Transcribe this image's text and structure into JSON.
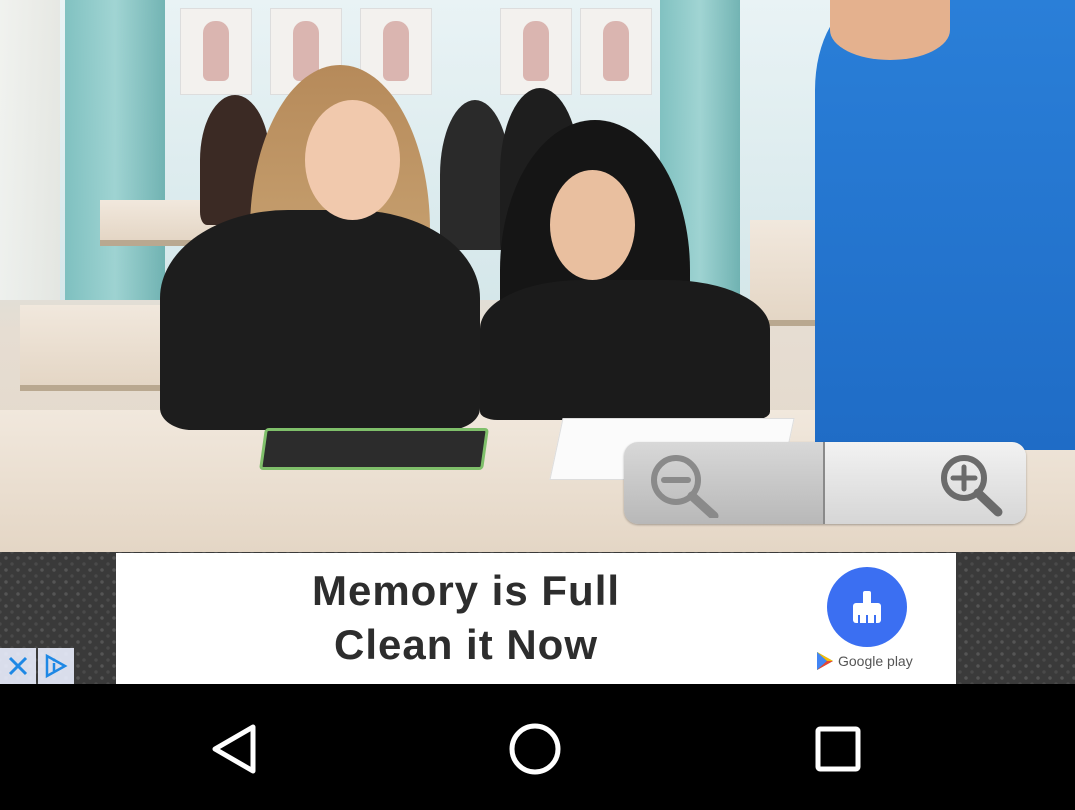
{
  "photo": {
    "alt_icon": "classroom-photo"
  },
  "zoom": {
    "zoom_out_icon": "zoom-out-icon",
    "zoom_in_icon": "zoom-in-icon"
  },
  "ad": {
    "line1": "Memory is Full",
    "line2": "Clean it Now",
    "store_label": "Google play",
    "app_icon": "broom-clean-icon",
    "close_icon": "close-icon",
    "adchoices_icon": "adchoices-icon"
  },
  "navbar": {
    "back_icon": "back-triangle-icon",
    "home_icon": "home-circle-icon",
    "recents_icon": "recents-square-icon"
  },
  "colors": {
    "ad_icon_blue": "#3b6ff2",
    "ad_text": "#2d2d2d",
    "nav_bg": "#000000"
  }
}
